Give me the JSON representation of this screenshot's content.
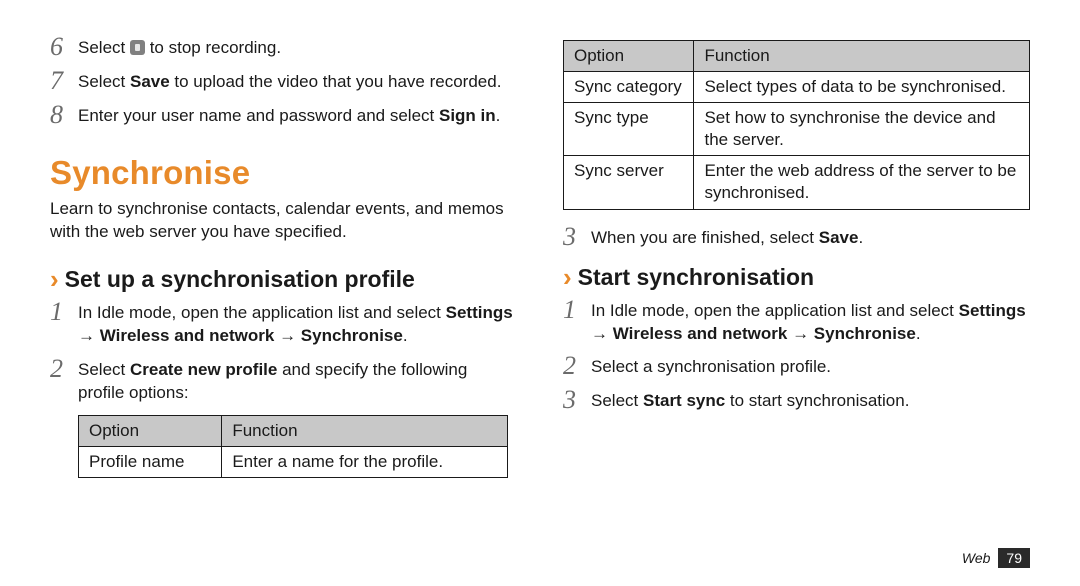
{
  "left": {
    "step6": {
      "num": "6",
      "pre": "Select ",
      "post": " to stop recording."
    },
    "step7": {
      "num": "7",
      "pre": "Select ",
      "bold": "Save",
      "post": " to upload the video that you have recorded."
    },
    "step8": {
      "num": "8",
      "pre": "Enter your user name and password and select ",
      "bold": "Sign in",
      "post": "."
    },
    "heading": "Synchronise",
    "intro": "Learn to synchronise contacts, calendar events, and memos with the web server you have specified.",
    "subheading": "Set up a synchronisation profile",
    "s1": {
      "num": "1",
      "pre": "In Idle mode, open the application list and select ",
      "bold": "Settings → Wireless and network → Synchronise",
      "post": "."
    },
    "s2": {
      "num": "2",
      "pre": "Select ",
      "bold": "Create new profile",
      "post": " and specify the following profile options:"
    },
    "table": {
      "h1": "Option",
      "h2": "Function",
      "r1c1": "Profile name",
      "r1c2": "Enter a name for the profile."
    }
  },
  "right": {
    "table": {
      "h1": "Option",
      "h2": "Function",
      "r1c1": "Sync category",
      "r1c2": "Select types of data to be synchronised.",
      "r2c1": "Sync type",
      "r2c2": "Set how to synchronise the device and the server.",
      "r3c1": "Sync server",
      "r3c2": "Enter the web address of the server to be synchronised."
    },
    "s3": {
      "num": "3",
      "pre": "When you are finished, select ",
      "bold": "Save",
      "post": "."
    },
    "subheading": "Start synchronisation",
    "ss1": {
      "num": "1",
      "pre": "In Idle mode, open the application list and select ",
      "bold": "Settings → Wireless and network → Synchronise",
      "post": "."
    },
    "ss2": {
      "num": "2",
      "txt": "Select a synchronisation profile."
    },
    "ss3": {
      "num": "3",
      "pre": "Select ",
      "bold": "Start sync",
      "post": " to start synchronisation."
    }
  },
  "footer": {
    "section": "Web",
    "page": "79"
  }
}
